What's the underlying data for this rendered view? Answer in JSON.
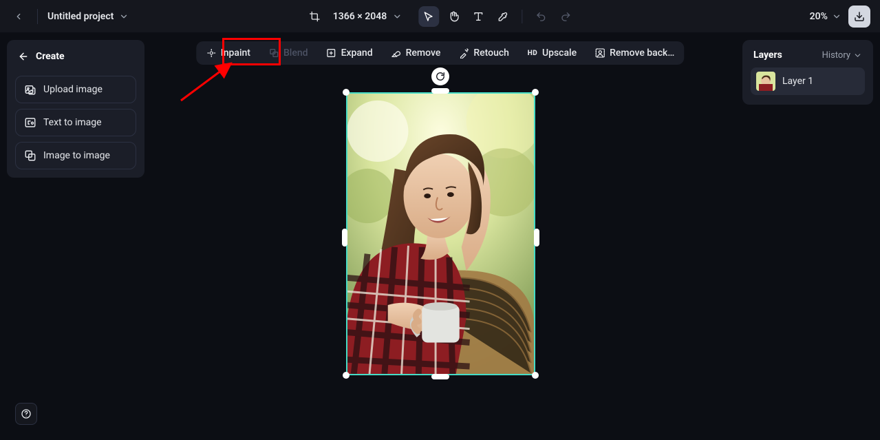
{
  "header": {
    "project_title": "Untitled project",
    "dimensions": "1366 × 2048",
    "zoom": "20%"
  },
  "sidebar": {
    "create_label": "Create",
    "items": [
      {
        "label": "Upload image"
      },
      {
        "label": "Text to image"
      },
      {
        "label": "Image to image"
      }
    ]
  },
  "action_bar": {
    "items": [
      {
        "label": "Inpaint"
      },
      {
        "label": "Blend"
      },
      {
        "label": "Expand"
      },
      {
        "label": "Remove"
      },
      {
        "label": "Retouch"
      },
      {
        "label": "Upscale"
      },
      {
        "label": "Remove back…"
      }
    ]
  },
  "layers_panel": {
    "title": "Layers",
    "history_label": "History",
    "layers": [
      {
        "label": "Layer 1"
      }
    ]
  }
}
